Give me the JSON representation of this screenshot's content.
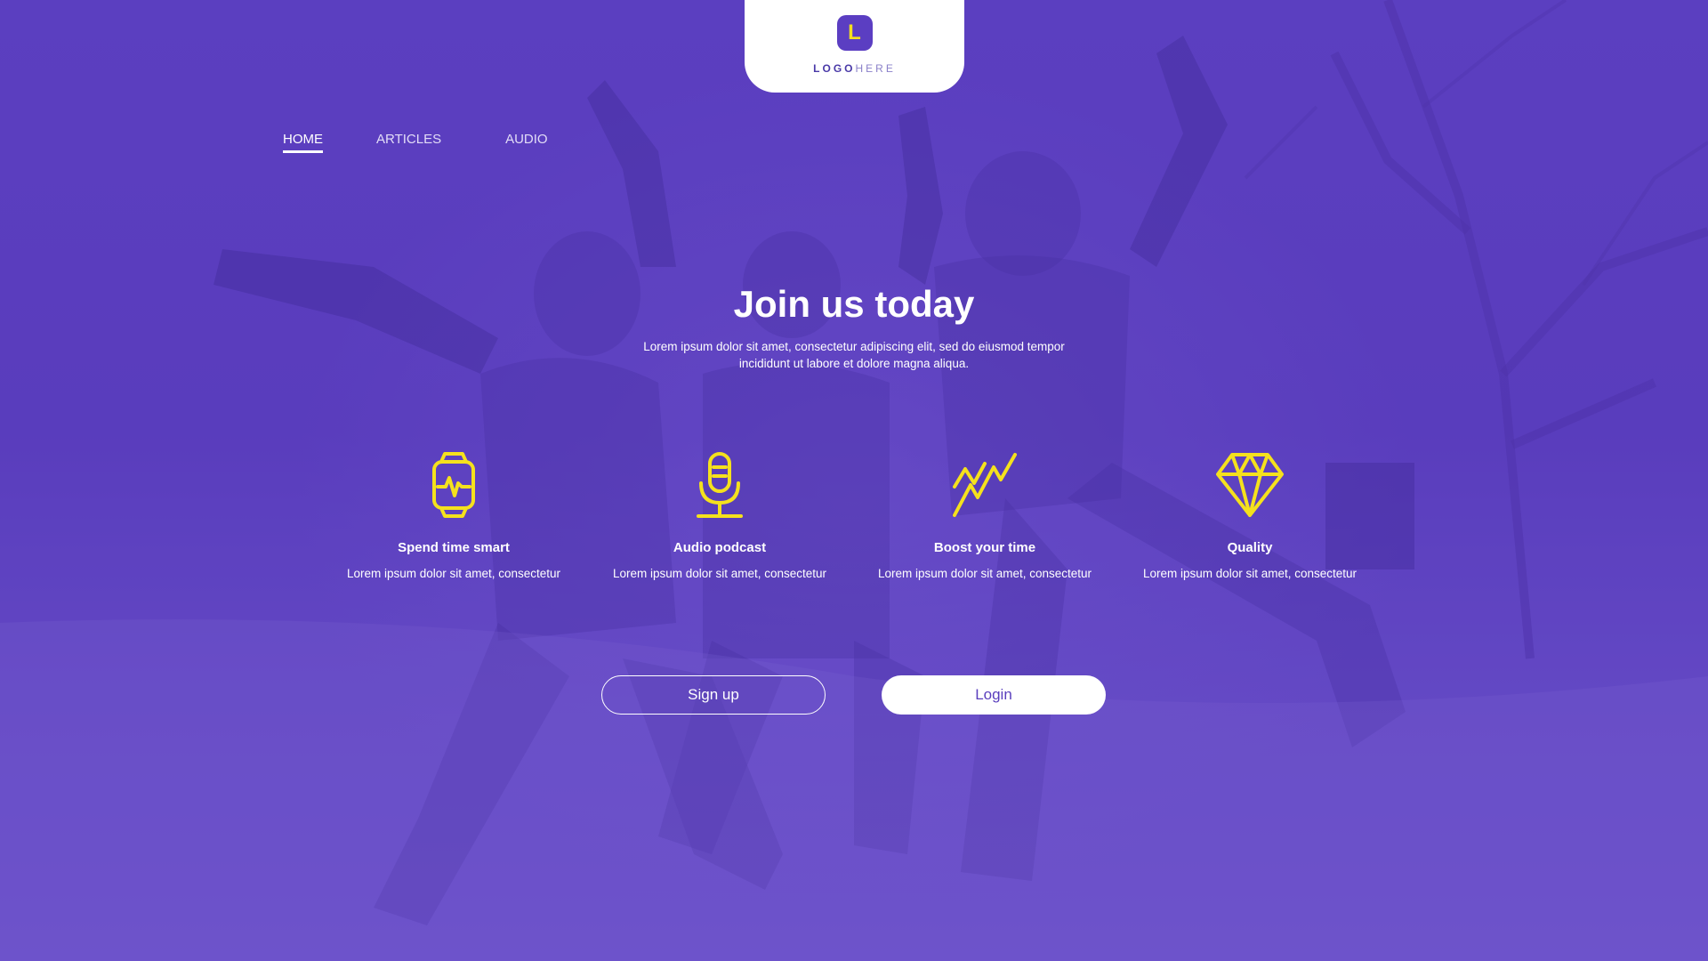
{
  "logo": {
    "mark": "L",
    "word_bold": "LOGO",
    "word_light": "HERE"
  },
  "nav": {
    "items": [
      {
        "label": "HOME",
        "active": true
      },
      {
        "label": "ARTICLES",
        "active": false
      },
      {
        "label": "AUDIO",
        "active": false
      }
    ]
  },
  "hero": {
    "title": "Join us today",
    "subtitle": "Lorem ipsum dolor sit amet, consectetur adipiscing elit, sed do eiusmod tempor incididunt ut labore et dolore magna aliqua."
  },
  "features": [
    {
      "icon": "smartwatch-icon",
      "title": "Spend time smart",
      "text": "Lorem ipsum dolor sit amet, consectetur"
    },
    {
      "icon": "microphone-icon",
      "title": "Audio podcast",
      "text": "Lorem ipsum dolor sit amet, consectetur"
    },
    {
      "icon": "zigzag-icon",
      "title": "Boost your time",
      "text": "Lorem ipsum dolor sit amet, consectetur"
    },
    {
      "icon": "diamond-icon",
      "title": "Quality",
      "text": "Lorem ipsum dolor sit amet, consectetur"
    }
  ],
  "buttons": {
    "signup": "Sign up",
    "login": "Login"
  },
  "colors": {
    "accent": "#f5e11d",
    "brand": "#5a3fbd",
    "text": "#ffffff"
  }
}
